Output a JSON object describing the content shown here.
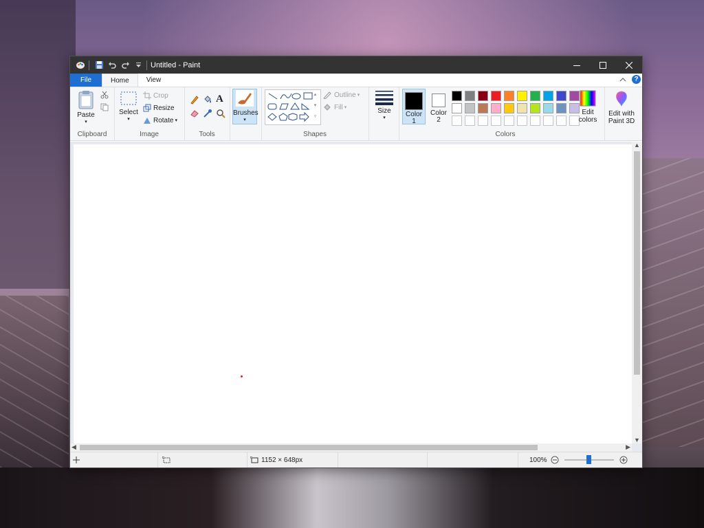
{
  "window": {
    "title": "Untitled - Paint"
  },
  "tabs": {
    "file": "File",
    "home": "Home",
    "view": "View"
  },
  "ribbon": {
    "clipboard": {
      "paste": "Paste",
      "label": "Clipboard"
    },
    "image": {
      "select": "Select",
      "crop": "Crop",
      "resize": "Resize",
      "rotate": "Rotate",
      "label": "Image"
    },
    "tools": {
      "label": "Tools"
    },
    "brushes": {
      "label": "Brushes"
    },
    "shapes": {
      "outline": "Outline",
      "fill": "Fill",
      "label": "Shapes"
    },
    "size": {
      "label": "Size"
    },
    "colors": {
      "color1": "Color\n1",
      "color2": "Color\n2",
      "label": "Colors",
      "edit": "Edit colors",
      "edit3d": "Edit with Paint 3D",
      "color1_value": "#000000",
      "color2_value": "#ffffff",
      "palette_row1": [
        "#000000",
        "#7f7f7f",
        "#880015",
        "#ed1c24",
        "#ff7f27",
        "#fff200",
        "#22b14c",
        "#00a2e8",
        "#3f48cc",
        "#a349a4"
      ],
      "palette_row2": [
        "#ffffff",
        "#c3c3c3",
        "#b97a57",
        "#ffaec9",
        "#ffc90e",
        "#efe4b0",
        "#b5e61d",
        "#99d9ea",
        "#7092be",
        "#c8bfe7"
      ]
    }
  },
  "statusbar": {
    "dimensions": "1152 × 648px",
    "zoom": "100%"
  }
}
